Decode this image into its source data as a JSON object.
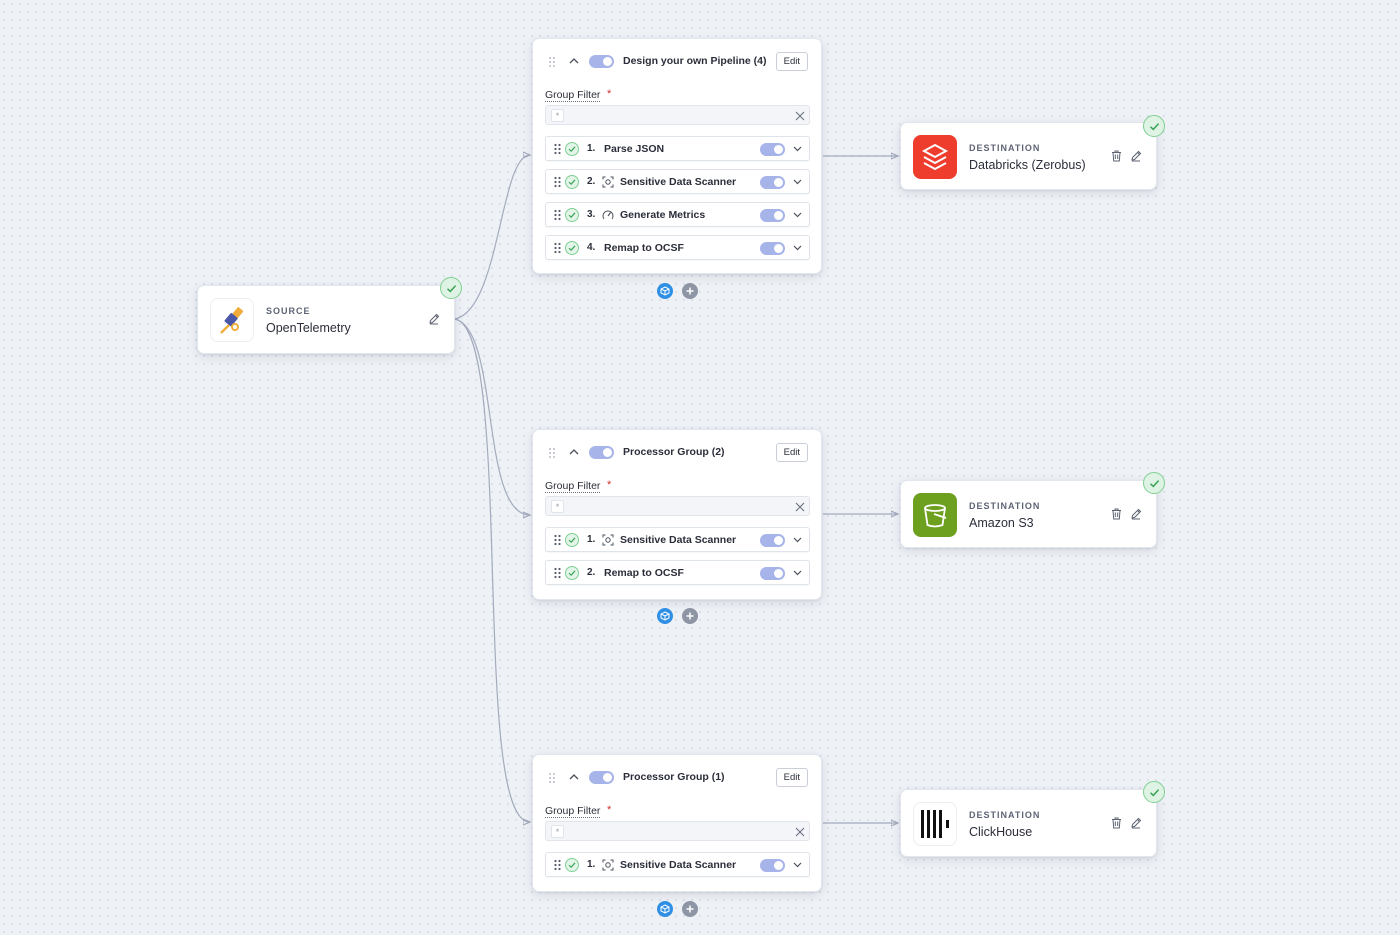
{
  "source": {
    "kicker": "SOURCE",
    "name": "OpenTelemetry",
    "icon": "telescope-icon"
  },
  "groups": [
    {
      "title": "Design your own Pipeline (4)",
      "edit_label": "Edit",
      "filter_label": "Group Filter",
      "required_mark": "*",
      "filter_value": "*",
      "processors": [
        {
          "num": "1.",
          "name": "Parse JSON",
          "icon": ""
        },
        {
          "num": "2.",
          "name": "Sensitive Data Scanner",
          "icon": "scanner-icon"
        },
        {
          "num": "3.",
          "name": "Generate Metrics",
          "icon": "gauge-icon"
        },
        {
          "num": "4.",
          "name": "Remap to OCSF",
          "icon": ""
        }
      ]
    },
    {
      "title": "Processor Group (2)",
      "edit_label": "Edit",
      "filter_label": "Group Filter",
      "required_mark": "*",
      "filter_value": "*",
      "processors": [
        {
          "num": "1.",
          "name": "Sensitive Data Scanner",
          "icon": "scanner-icon"
        },
        {
          "num": "2.",
          "name": "Remap to OCSF",
          "icon": ""
        }
      ]
    },
    {
      "title": "Processor Group (1)",
      "edit_label": "Edit",
      "filter_label": "Group Filter",
      "required_mark": "*",
      "filter_value": "*",
      "processors": [
        {
          "num": "1.",
          "name": "Sensitive Data Scanner",
          "icon": "scanner-icon"
        }
      ]
    }
  ],
  "destinations": [
    {
      "kicker": "DESTINATION",
      "name": "Databricks (Zerobus)",
      "icon": "databricks-icon",
      "color": "#ee3d2c"
    },
    {
      "kicker": "DESTINATION",
      "name": "Amazon S3",
      "icon": "s3-bucket-icon",
      "color": "#6ea020"
    },
    {
      "kicker": "DESTINATION",
      "name": "ClickHouse",
      "icon": "clickhouse-icon",
      "color": "#111111"
    }
  ],
  "colors": {
    "toggle_on": "#a7b4ea",
    "status_ok": "#7fcf93",
    "add_pipeline": "#2f8fe5",
    "edge": "#a3abbd"
  }
}
